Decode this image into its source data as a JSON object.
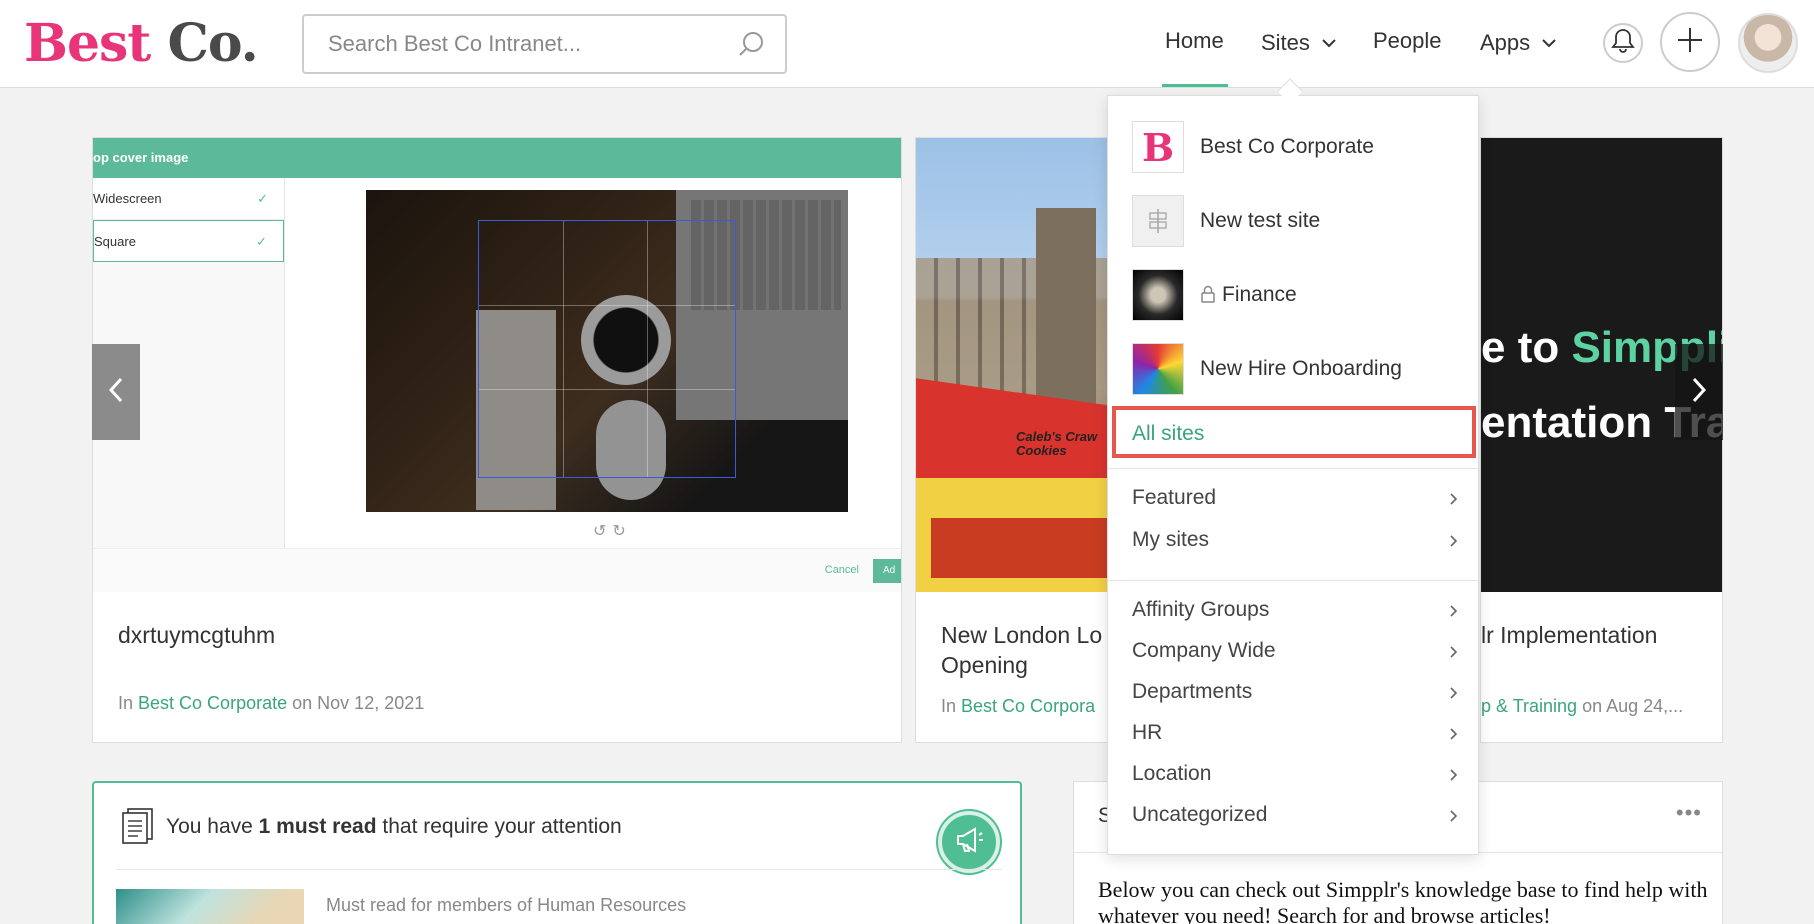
{
  "header": {
    "logo_part1": "Best",
    "logo_part2": "Co.",
    "search_placeholder": "Search Best Co Intranet...",
    "nav": {
      "home": "Home",
      "sites": "Sites",
      "people": "People",
      "apps": "Apps"
    },
    "active_nav": "Home",
    "accent_color": "#4fbf93",
    "brand_color": "#e8357a"
  },
  "carousel": {
    "cards": [
      {
        "title": "dxrtuymcgtuhm",
        "meta_prefix": "In",
        "site": "Best Co Corporate",
        "meta_on": "on",
        "date": "Nov 12, 2021",
        "image": {
          "header": "op cover image",
          "options": [
            "Widescreen",
            "Square"
          ],
          "cancel": "Cancel",
          "add": "Ad"
        }
      },
      {
        "title_line1": "New London Lo",
        "title_line2": "Opening",
        "meta_prefix": "In",
        "site": "Best Co Corpora",
        "sign": "Caleb's Craw\nCookies"
      },
      {
        "title": "lr Implementation",
        "site_suffix": "p & Training",
        "meta_on": "on",
        "date": "Aug 24,...",
        "img_line1a": "e to ",
        "img_line1b": "Simppli",
        "img_line2": "entation Tra"
      }
    ]
  },
  "must_read": {
    "text_before": "You have ",
    "text_bold": "1 must read",
    "text_after": " that require your attention",
    "item_label": "Must read for members of Human Resources"
  },
  "widget": {
    "title": "S",
    "menu": "•••",
    "body": "Below you can check out Simpplr's knowledge base to find help with whatever you need! Search for and browse articles!"
  },
  "sites_dropdown": {
    "recent_sites": [
      {
        "name": "Best Co Corporate",
        "thumb": "B",
        "locked": false
      },
      {
        "name": "New test site",
        "thumb": "signpost-icon",
        "locked": false
      },
      {
        "name": "Finance",
        "thumb": "finance-photo",
        "locked": true
      },
      {
        "name": "New Hire Onboarding",
        "thumb": "balloon-photo",
        "locked": false
      }
    ],
    "all_sites": "All sites",
    "groups": [
      "Featured",
      "My sites"
    ],
    "categories": [
      "Affinity Groups",
      "Company Wide",
      "Departments",
      "HR",
      "Location",
      "Uncategorized"
    ],
    "highlight_color": "#e5584b"
  }
}
